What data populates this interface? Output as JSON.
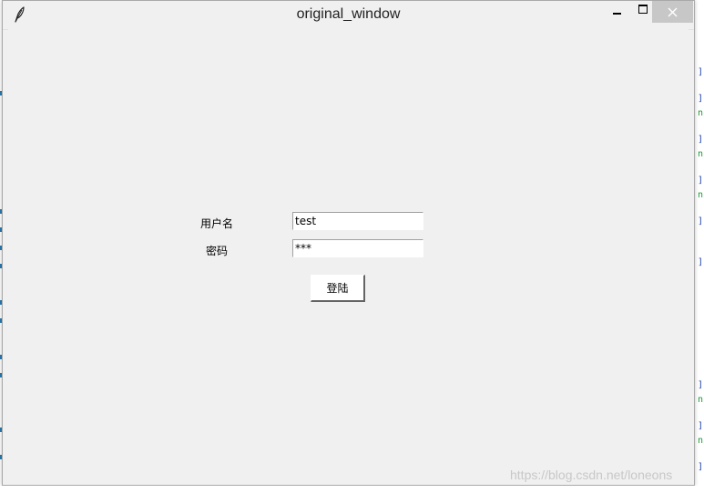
{
  "window": {
    "title": "original_window",
    "controls": {
      "minimize_icon": "minimize-icon",
      "maximize_icon": "maximize-icon",
      "close_glyph": "✕"
    }
  },
  "form": {
    "username_label": "用户名",
    "username_value": "test",
    "password_label": "密码",
    "password_value": "***",
    "login_label": "登陆"
  },
  "watermark": "https://blog.csdn.net/loneons",
  "colors": {
    "window_bg": "#f0f0f0",
    "close_hover_bg": "#c7c7c7",
    "entry_bg": "#ffffff"
  }
}
